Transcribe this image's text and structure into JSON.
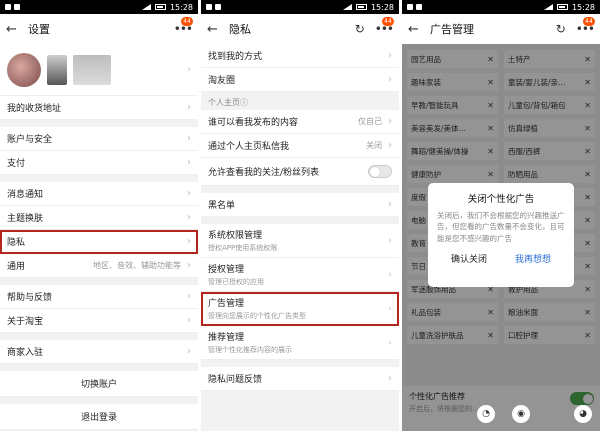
{
  "status": {
    "time": "15:28"
  },
  "panel1": {
    "title": "设置",
    "badge": "44",
    "rows_a": [
      {
        "label": "我的收货地址"
      }
    ],
    "rows_b": [
      {
        "label": "账户与安全"
      },
      {
        "label": "支付"
      }
    ],
    "rows_c": [
      {
        "label": "消息通知"
      },
      {
        "label": "主题换肤"
      }
    ],
    "privacy": "隐私",
    "general": {
      "label": "通用",
      "value": "地区、音效、辅助功能等"
    },
    "rows_d": [
      {
        "label": "帮助与反馈"
      },
      {
        "label": "关于淘宝"
      }
    ],
    "merchant": "商家入驻",
    "switch_account": "切换账户",
    "logout": "退出登录"
  },
  "panel2": {
    "title": "隐私",
    "badge": "44",
    "rows_a": [
      {
        "label": "找到我的方式"
      },
      {
        "label": "淘友圈"
      }
    ],
    "section": "个人主页ⓘ",
    "rows_b": [
      {
        "label": "谁可以看我发布的内容",
        "value": "仅自己"
      },
      {
        "label": "通过个人主页私信我",
        "value": "关闭"
      }
    ],
    "follow_toggle": "允许查看我的关注/粉丝列表",
    "blacklist": "黑名单",
    "sub_rows": [
      {
        "label": "系统权限管理",
        "desc": "授权APP使用系统权限"
      },
      {
        "label": "授权管理",
        "desc": "管理已授权的应用"
      },
      {
        "label": "广告管理",
        "desc": "管理向您展示的个性化广告类型"
      },
      {
        "label": "推荐管理",
        "desc": "管理个性化推荐内容的展示"
      }
    ],
    "feedback": "隐私问题反馈"
  },
  "panel3": {
    "title": "广告管理",
    "badge": "44",
    "chips": [
      "园艺用品",
      "土特产",
      "趣味家装",
      "童装/婴儿装/亲…",
      "早教/智能玩具",
      "儿童包/背包/箱包",
      "美容美发/美体…",
      "仿真绿植",
      "舞蹈/健美操/体操",
      "西服/西裤",
      "健康防护",
      "防晒用品",
      "度假",
      "…",
      "电脑",
      "…",
      "教育",
      "…",
      "节日",
      "…",
      "军迷服饰用品",
      "救护用品",
      "礼品包装",
      "粮油米面",
      "儿童洗浴护肤品",
      "口腔护理"
    ],
    "personal_ads": "个性化广告推荐",
    "personal_ads_desc": "开启后，将根据您的…",
    "dialog": {
      "title": "关闭个性化广告",
      "body": "关闭后，我们不会根据您的兴趣推送广告，但您看的广告数量不会变化，且可能是您不感兴趣的广告",
      "cancel": "确认关闭",
      "confirm": "我再想想"
    }
  }
}
